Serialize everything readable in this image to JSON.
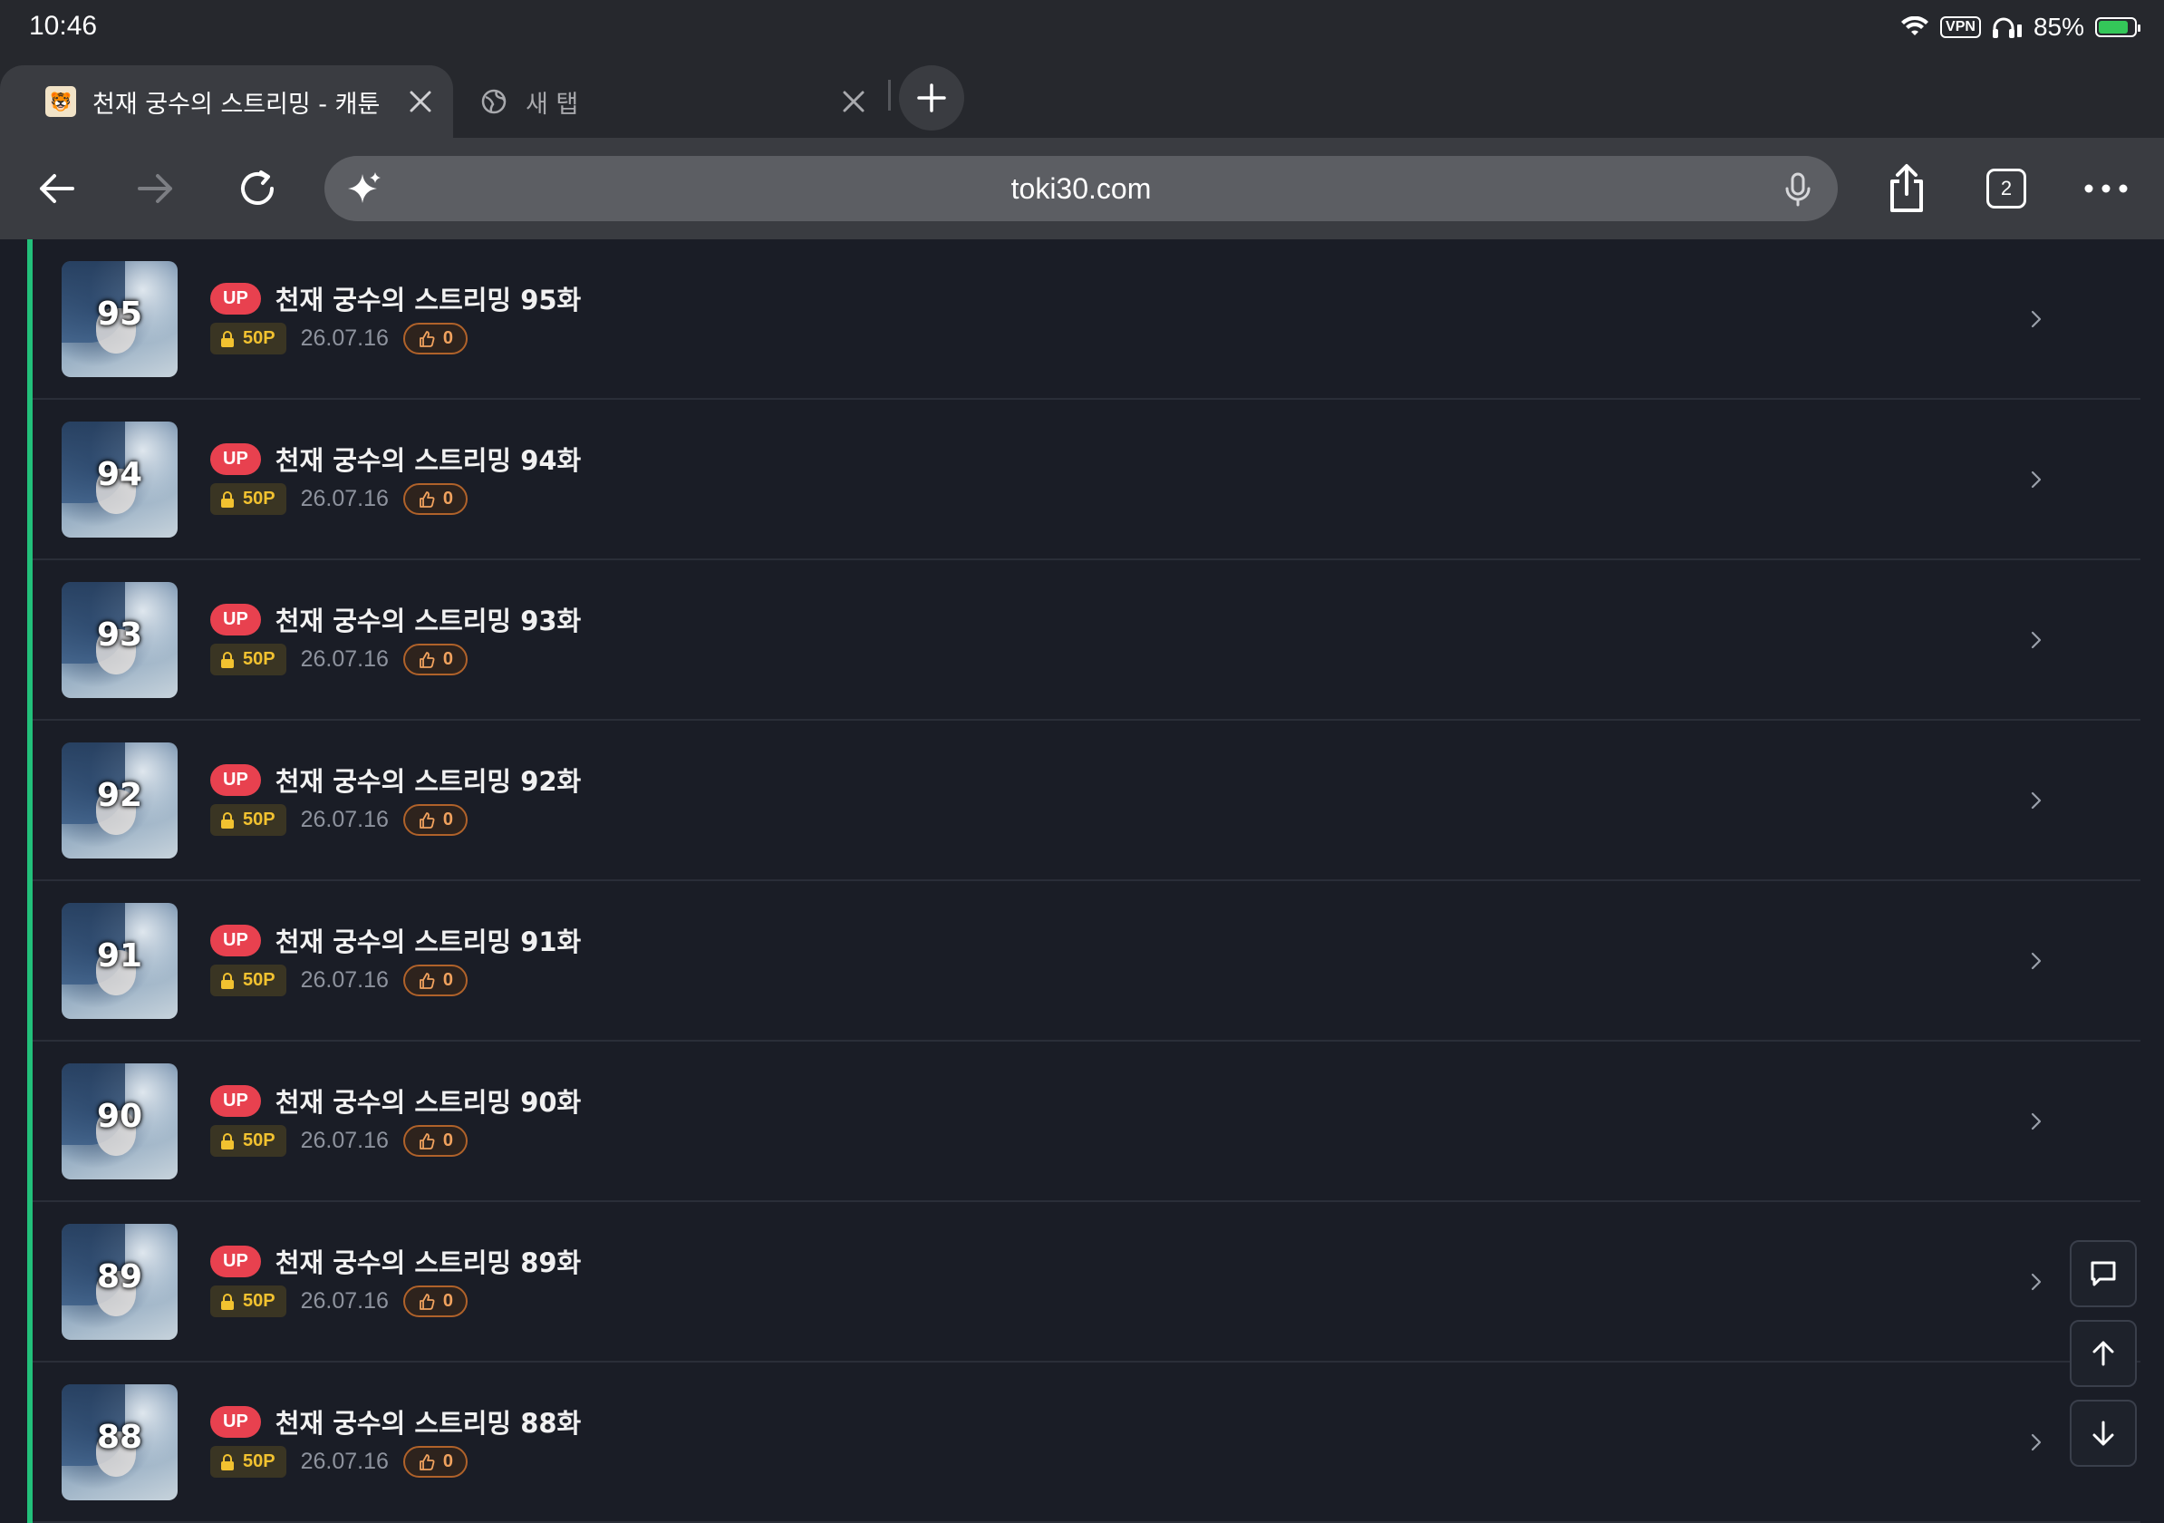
{
  "status_bar": {
    "time": "10:46",
    "vpn_label": "VPN",
    "battery_percent": "85%",
    "battery_level": 0.85
  },
  "tabs": [
    {
      "title": "천재 궁수의 스트리밍 - 캐툰",
      "active": true,
      "icon": "site-favicon"
    },
    {
      "title": "새 탭",
      "active": false,
      "icon": "globe-icon"
    }
  ],
  "toolbar": {
    "url": "toki30.com",
    "tab_count": "2",
    "colors": {
      "bar": "#3a3c41",
      "url_field": "#5c5e63"
    }
  },
  "episodes": [
    {
      "thumb_number": "95",
      "badge": "UP",
      "title": "천재 궁수의 스트리밍 95화",
      "price": "50P",
      "date": "26.07.16",
      "likes": "0"
    },
    {
      "thumb_number": "94",
      "badge": "UP",
      "title": "천재 궁수의 스트리밍 94화",
      "price": "50P",
      "date": "26.07.16",
      "likes": "0"
    },
    {
      "thumb_number": "93",
      "badge": "UP",
      "title": "천재 궁수의 스트리밍 93화",
      "price": "50P",
      "date": "26.07.16",
      "likes": "0"
    },
    {
      "thumb_number": "92",
      "badge": "UP",
      "title": "천재 궁수의 스트리밍 92화",
      "price": "50P",
      "date": "26.07.16",
      "likes": "0"
    },
    {
      "thumb_number": "91",
      "badge": "UP",
      "title": "천재 궁수의 스트리밍 91화",
      "price": "50P",
      "date": "26.07.16",
      "likes": "0"
    },
    {
      "thumb_number": "90",
      "badge": "UP",
      "title": "천재 궁수의 스트리밍 90화",
      "price": "50P",
      "date": "26.07.16",
      "likes": "0"
    },
    {
      "thumb_number": "89",
      "badge": "UP",
      "title": "천재 궁수의 스트리밍 89화",
      "price": "50P",
      "date": "26.07.16",
      "likes": "0"
    },
    {
      "thumb_number": "88",
      "badge": "UP",
      "title": "천재 궁수의 스트리밍 88화",
      "price": "50P",
      "date": "26.07.16",
      "likes": "0"
    }
  ],
  "floating_buttons": [
    "comment-icon",
    "arrow-up-icon",
    "arrow-down-icon"
  ],
  "colors": {
    "page_background": "#1a1d26",
    "accent_bar": "#22c07a",
    "up_badge": "#e8414f",
    "price_text": "#f2c230",
    "likes_text": "#f1a25e"
  }
}
